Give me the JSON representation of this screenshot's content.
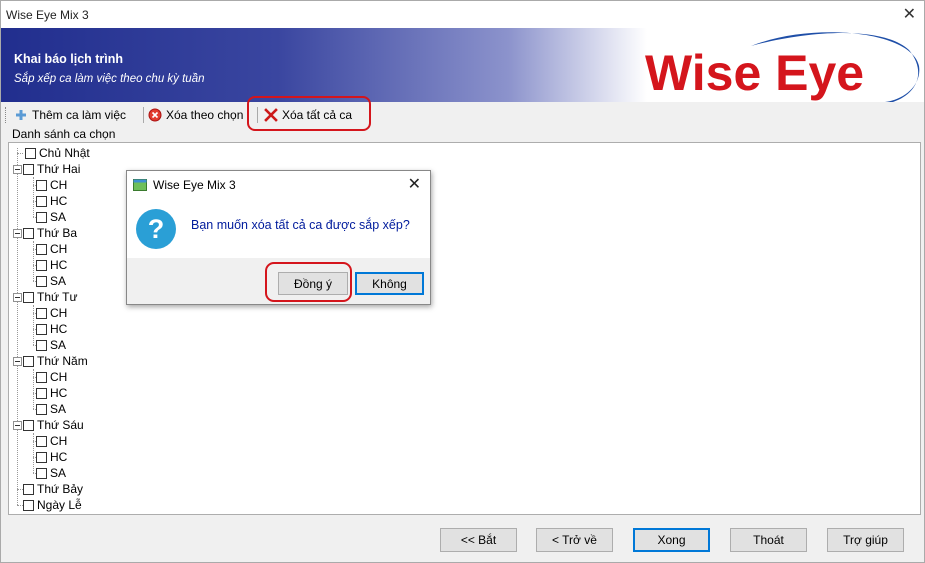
{
  "window": {
    "title": "Wise Eye Mix 3",
    "close": "✕"
  },
  "banner": {
    "heading": "Khai báo lịch trình",
    "subheading": "Sắp xếp ca làm việc theo chu kỳ tuần",
    "logo_text": "Wise Eye",
    "logo_color": "#d4151c",
    "swoosh_color": "#1f4fa8"
  },
  "toolbar": {
    "add_label": "Thêm ca làm việc",
    "delete_selected_label": "Xóa theo chọn",
    "delete_all_label": "Xóa tất cả ca"
  },
  "group_label": "Danh sánh ca chọn",
  "tree": {
    "days": [
      {
        "label": "Chủ Nhật",
        "shifts": []
      },
      {
        "label": "Thứ Hai",
        "shifts": [
          "CH",
          "HC",
          "SA"
        ]
      },
      {
        "label": "Thứ Ba",
        "shifts": [
          "CH",
          "HC",
          "SA"
        ]
      },
      {
        "label": "Thứ Tư",
        "shifts": [
          "CH",
          "HC",
          "SA"
        ]
      },
      {
        "label": "Thứ Năm",
        "shifts": [
          "CH",
          "HC",
          "SA"
        ]
      },
      {
        "label": "Thứ Sáu",
        "shifts": [
          "CH",
          "HC",
          "SA"
        ]
      },
      {
        "label": "Thứ Bảy",
        "shifts": []
      },
      {
        "label": "Ngày Lễ",
        "shifts": []
      }
    ]
  },
  "footer": {
    "start_label": "<<  Bắt",
    "back_label": "<  Trở về",
    "done_label": "Xong",
    "exit_label": "Thoát",
    "help_label": "Trợ giúp"
  },
  "dialog": {
    "title": "Wise Eye Mix 3",
    "close": "✕",
    "message": "Bạn muốn xóa tất cả ca được sắp xếp?",
    "yes_label": "Đồng ý",
    "no_label": "Không",
    "icon": "question-icon"
  },
  "colors": {
    "banner_dark": "#212e8e",
    "highlight_ring": "#d4151c",
    "dialog_text": "#001b9c",
    "question_icon": "#2a9fd6"
  }
}
